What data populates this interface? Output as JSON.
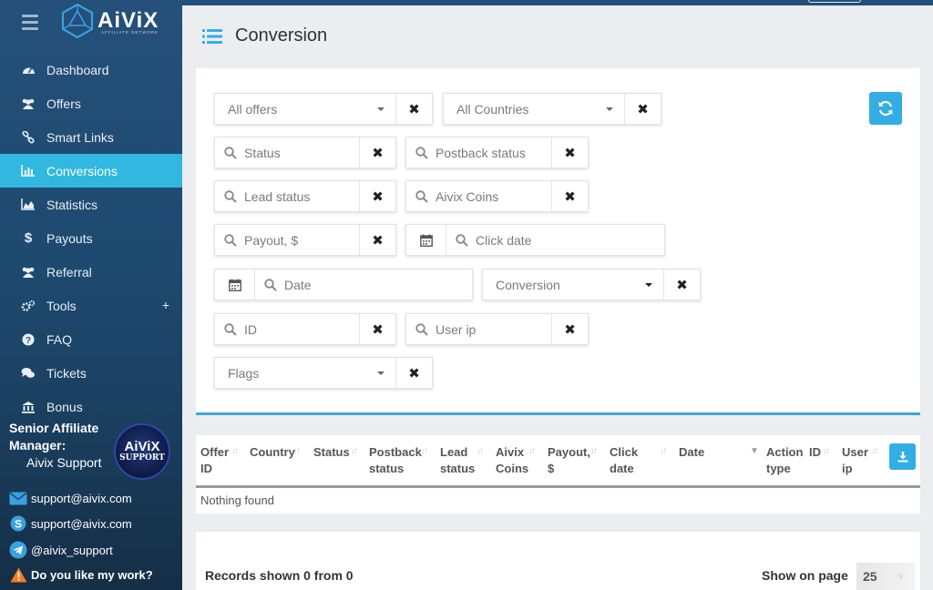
{
  "app": {
    "logo_text": "AiViX",
    "logo_subtitle": "AFFILIATE NETWORK"
  },
  "sidebar": {
    "items": [
      {
        "label": "Dashboard",
        "icon": "dashboard-icon"
      },
      {
        "label": "Offers",
        "icon": "users-icon"
      },
      {
        "label": "Smart Links",
        "icon": "link-icon"
      },
      {
        "label": "Conversions",
        "icon": "bar-chart-icon",
        "active": true
      },
      {
        "label": "Statistics",
        "icon": "area-chart-icon"
      },
      {
        "label": "Payouts",
        "icon": "dollar-icon"
      },
      {
        "label": "Referral",
        "icon": "users-icon"
      },
      {
        "label": "Tools",
        "icon": "gears-icon",
        "expandable": "+"
      },
      {
        "label": "FAQ",
        "icon": "question-icon"
      },
      {
        "label": "Tickets",
        "icon": "comments-icon"
      },
      {
        "label": "Bonus",
        "icon": "bank-icon"
      }
    ],
    "manager": {
      "title_line1": "Senior Affiliate",
      "title_line2": "Manager:",
      "name": "Aivix Support",
      "badge_line1": "AiViX",
      "badge_line2": "SUPPORT"
    },
    "contacts": [
      {
        "icon": "envelope-icon",
        "text": "support@aivix.com"
      },
      {
        "icon": "skype-icon",
        "text": "support@aivix.com"
      },
      {
        "icon": "telegram-icon",
        "text": "@aivix_support"
      },
      {
        "icon": "warning-icon",
        "text": "Do you like my work?"
      }
    ]
  },
  "header": {
    "title": "Conversion"
  },
  "filters": {
    "offers": "All offers",
    "countries": "All Countries",
    "status": "Status",
    "postback_status": "Postback status",
    "lead_status": "Lead status",
    "aivix_coins": "Aivix Coins",
    "payout": "Payout, $",
    "click_date": "Click date",
    "date": "Date",
    "conversion": "Conversion",
    "id": "ID",
    "user_ip": "User ip",
    "flags": "Flags",
    "clear_glyph": "✖"
  },
  "table": {
    "columns": [
      {
        "l1": "Offer",
        "l2": "ID"
      },
      {
        "l1": "Country",
        "l2": ""
      },
      {
        "l1": "Status",
        "l2": ""
      },
      {
        "l1": "Postback",
        "l2": "status"
      },
      {
        "l1": "Lead",
        "l2": "status"
      },
      {
        "l1": "Aivix",
        "l2": "Coins"
      },
      {
        "l1": "Payout,",
        "l2": "$"
      },
      {
        "l1": "Click",
        "l2": "date"
      },
      {
        "l1": "Date",
        "l2": ""
      },
      {
        "l1": "Action",
        "l2": "type"
      },
      {
        "l1": "ID",
        "l2": ""
      },
      {
        "l1": "User",
        "l2": "ip"
      }
    ],
    "empty_text": "Nothing found"
  },
  "footer": {
    "records_text": "Records shown 0 from 0",
    "show_on_page_label": "Show on page",
    "page_size": "25"
  },
  "colors": {
    "accent": "#31b7e0",
    "sidebar": "#1e4a70",
    "button": "#33aee4"
  }
}
